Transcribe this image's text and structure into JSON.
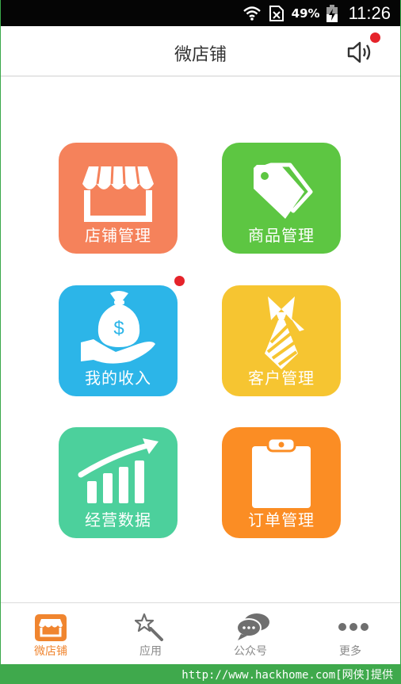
{
  "status_bar": {
    "battery_pct": "49%",
    "time": "11:26",
    "icons": [
      "wifi-icon",
      "no-sim-icon",
      "battery-charging-icon"
    ]
  },
  "header": {
    "title": "微店铺",
    "speaker_icon": "speaker-icon",
    "has_notification_dot": true
  },
  "tiles": [
    {
      "label": "店铺管理",
      "icon": "storefront-icon",
      "color": "#f5825b"
    },
    {
      "label": "商品管理",
      "icon": "price-tag-icon",
      "color": "#5dc642"
    },
    {
      "label": "我的收入",
      "icon": "money-bag-icon",
      "color": "#2cb5e8",
      "has_notification_dot": true
    },
    {
      "label": "客户管理",
      "icon": "necktie-icon",
      "color": "#f6c531"
    },
    {
      "label": "经营数据",
      "icon": "growth-chart-icon",
      "color": "#4cd09c"
    },
    {
      "label": "订单管理",
      "icon": "clipboard-icon",
      "color": "#fb8d24"
    }
  ],
  "bottom_nav": [
    {
      "label": "微店铺",
      "icon": "shop-icon",
      "active": true
    },
    {
      "label": "应用",
      "icon": "magic-wand-icon",
      "active": false
    },
    {
      "label": "公众号",
      "icon": "chat-bubbles-icon",
      "active": false
    },
    {
      "label": "更多",
      "icon": "more-dots-icon",
      "active": false
    }
  ],
  "colors": {
    "active": "#f0852f",
    "inactive": "#8a8a8a",
    "badge": "#e5232a"
  },
  "watermark": "http://www.hackhome.com[网侠]提供"
}
